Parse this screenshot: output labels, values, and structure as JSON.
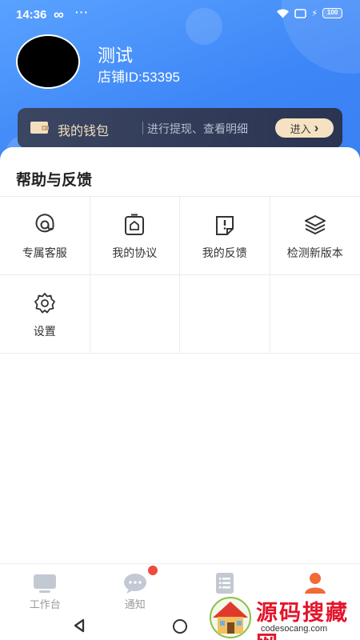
{
  "status_bar": {
    "time": "14:36",
    "infinity": "∞",
    "dots": "···",
    "battery": "100"
  },
  "profile": {
    "name": "测试",
    "shop_id": "店铺ID:53395"
  },
  "wallet": {
    "title": "我的钱包",
    "subtitle": "进行提现、查看明细",
    "enter_label": "进入",
    "enter_arrow": "›"
  },
  "help": {
    "title": "帮助与反馈",
    "items": [
      {
        "label": "专属客服",
        "icon": "at-icon"
      },
      {
        "label": "我的协议",
        "icon": "agreement-icon"
      },
      {
        "label": "我的反馈",
        "icon": "feedback-icon"
      },
      {
        "label": "检测新版本",
        "icon": "layers-icon"
      },
      {
        "label": "设置",
        "icon": "gear-icon"
      }
    ]
  },
  "tabs": [
    {
      "label": "工作台",
      "icon": "monitor-icon"
    },
    {
      "label": "通知",
      "icon": "chat-bubble-icon",
      "badge": true
    },
    {
      "label": "",
      "icon": "list-icon"
    },
    {
      "label": "",
      "icon": "person-icon",
      "active": true
    }
  ],
  "colors": {
    "header": "#3d86f7",
    "wallet_card": "#2f3953",
    "wallet_gold": "#f2dfbd",
    "badge": "#ef4b3f",
    "active_tab": "#f26a35"
  },
  "watermark": {
    "title": "源码搜藏网",
    "url": "codesocang.com"
  }
}
